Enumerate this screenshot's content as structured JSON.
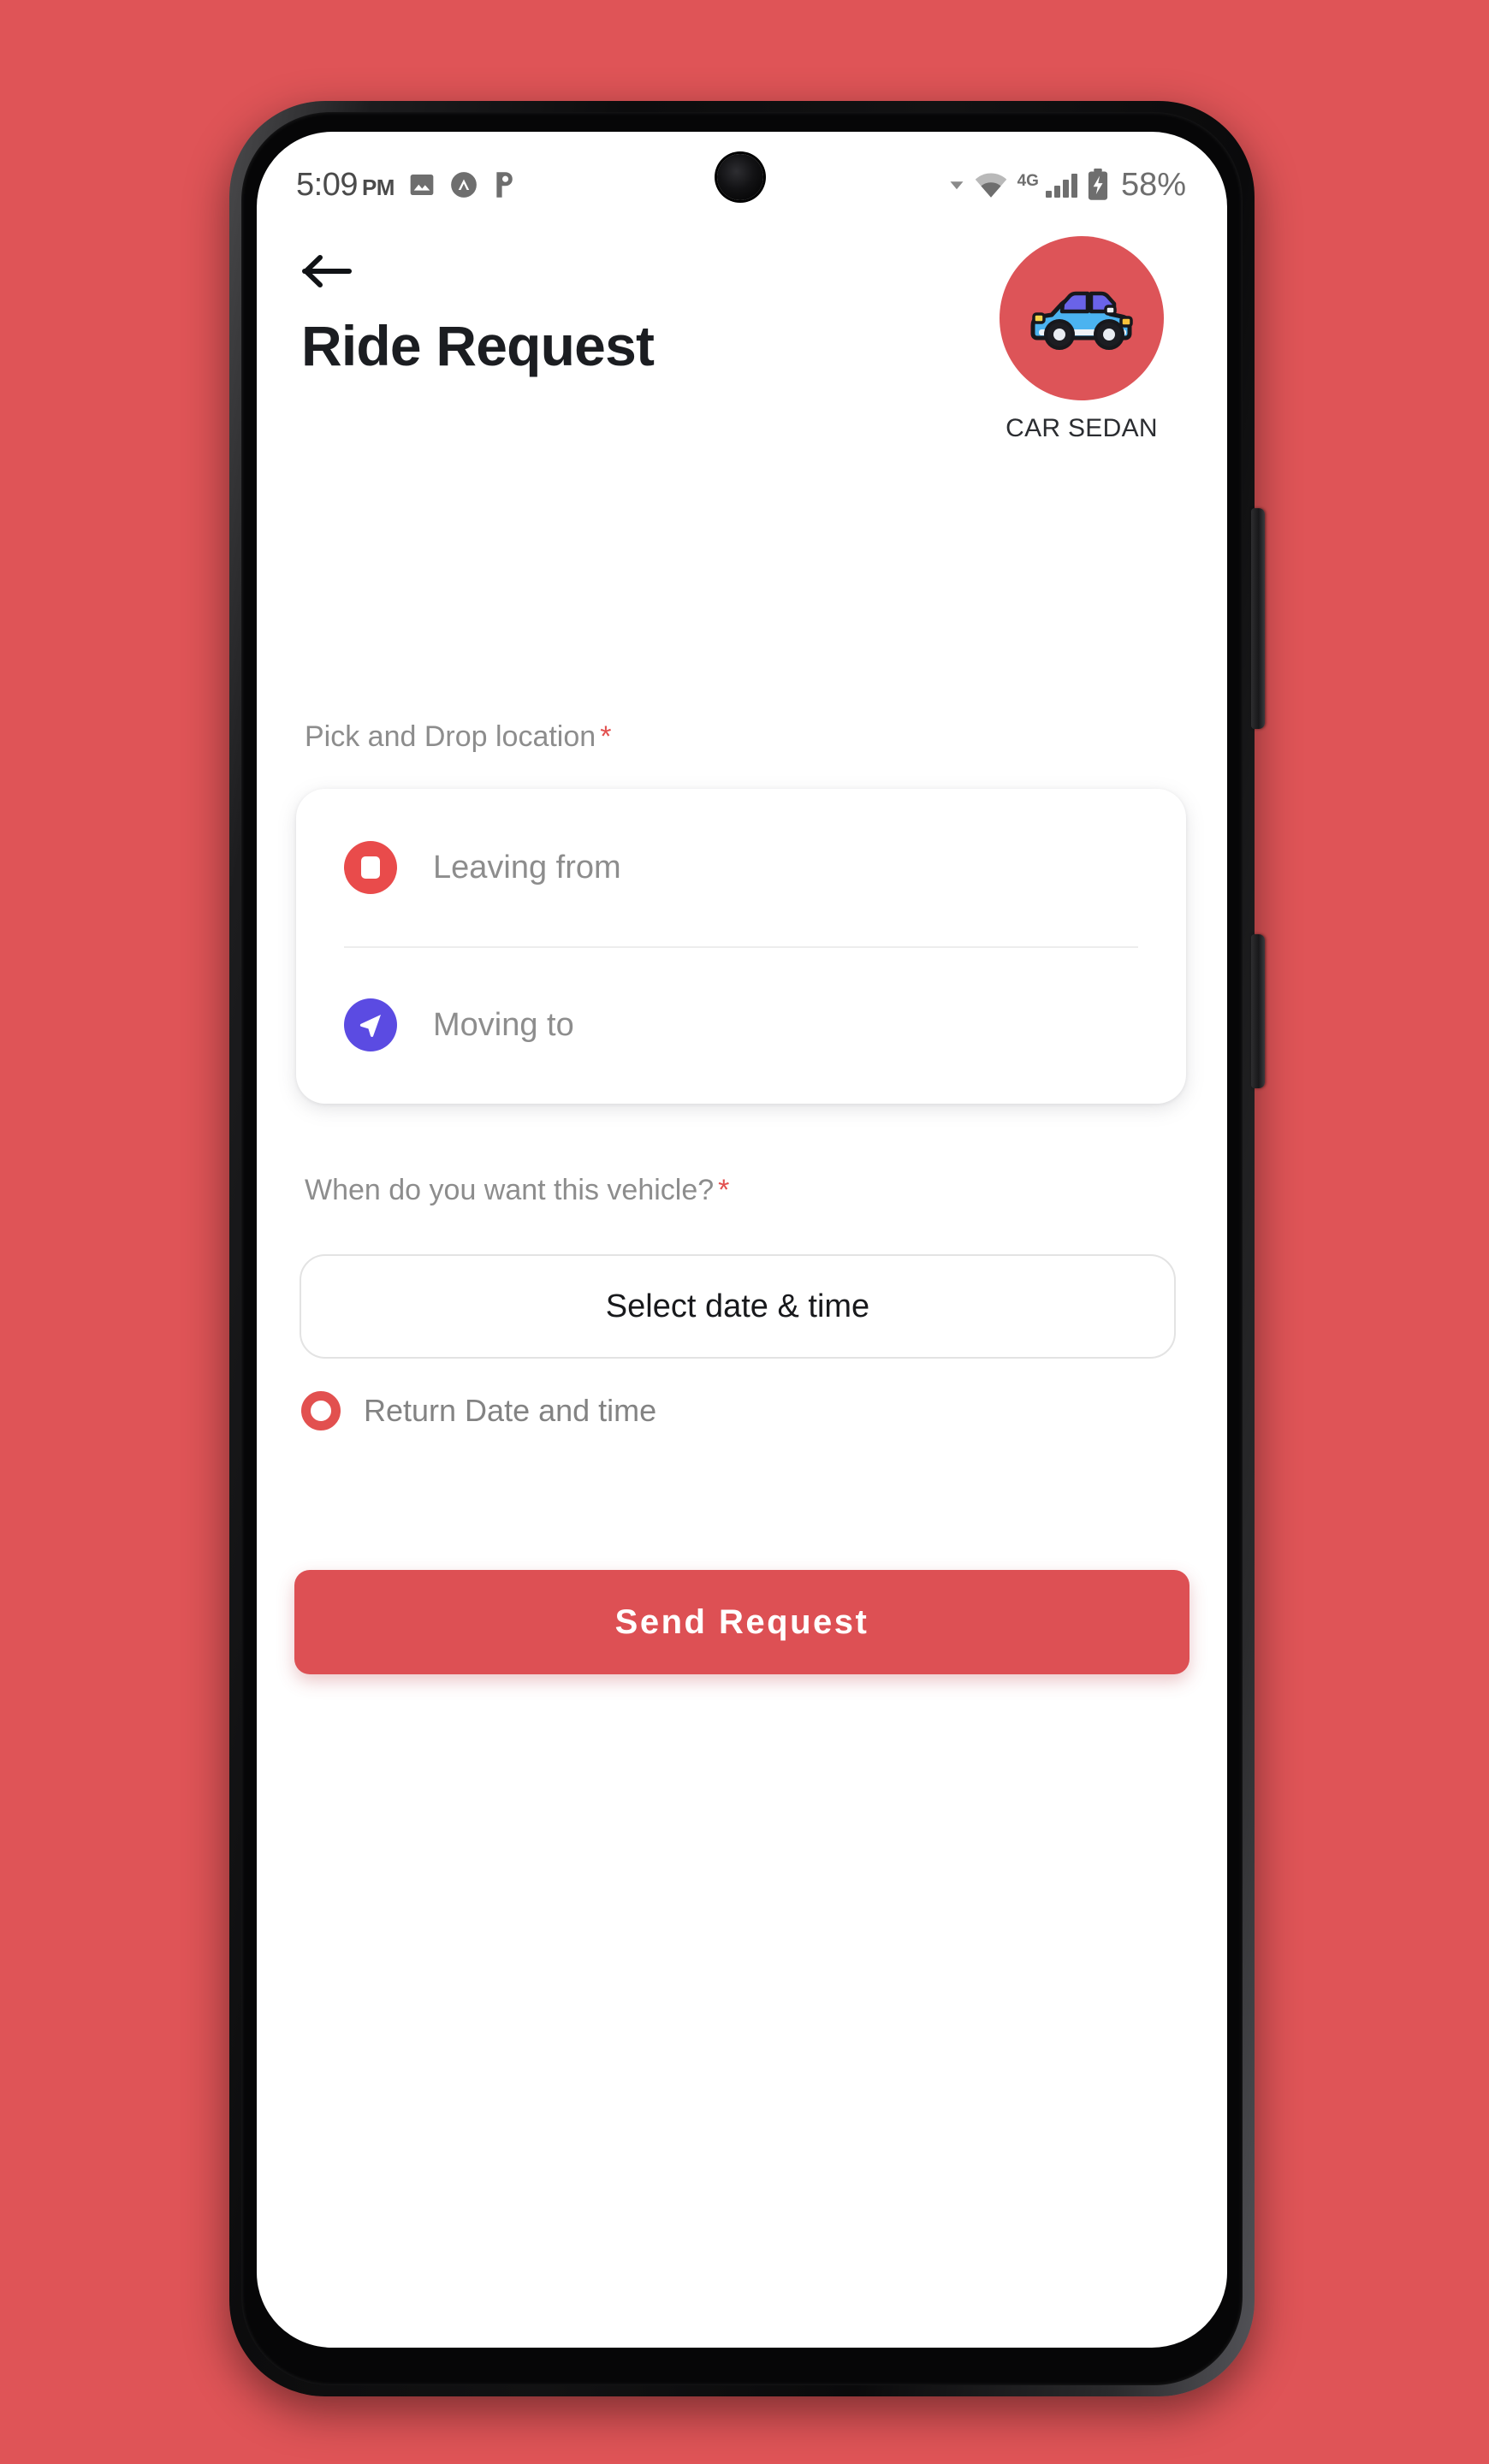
{
  "theme": {
    "page_background": "#DF5457",
    "accent_red": "#DD5054",
    "badge_red": "#DD5458",
    "pickup_red": "#E94B4B",
    "drop_purple": "#5B4BE2",
    "title_color": "#1b1d21",
    "muted_text": "#8d8d8d"
  },
  "status_bar": {
    "time": "5:09",
    "time_ampm": "PM",
    "left_icons": [
      "image-icon",
      "nova-launcher-icon",
      "parking-p-icon"
    ],
    "network_type": "4G",
    "right_icons": [
      "dropdown-caret-icon",
      "wifi-icon",
      "signal-bars-icon",
      "battery-charging-icon"
    ],
    "battery_percent": "58%"
  },
  "header": {
    "back_icon": "back-arrow-icon",
    "title": "Ride Request",
    "vehicle": {
      "icon": "car-sedan-icon",
      "label": "CAR SEDAN"
    }
  },
  "form": {
    "location_section": {
      "label": "Pick and Drop location",
      "required_marker": "*",
      "rows": [
        {
          "icon": "stop-square-icon",
          "placeholder": "Leaving from"
        },
        {
          "icon": "navigation-arrow-icon",
          "placeholder": "Moving to"
        }
      ]
    },
    "schedule_section": {
      "label": "When do you want this vehicle?",
      "required_marker": "*",
      "datetime_button_label": "Select date & time"
    },
    "return_option": {
      "icon": "radio-unchecked-icon",
      "label": "Return Date and time",
      "checked": false
    },
    "submit_button_label": "Send Request"
  }
}
